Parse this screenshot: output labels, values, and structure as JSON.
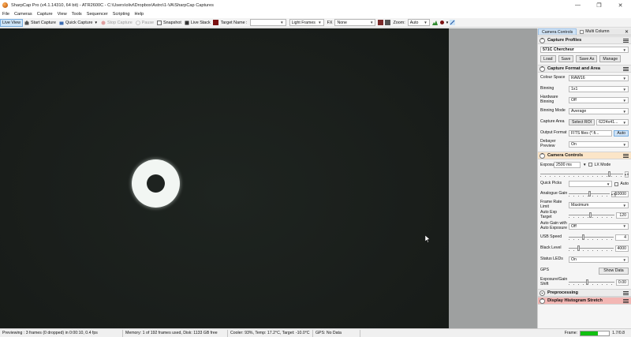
{
  "window": {
    "title": "SharpCap Pro (v4.1.14310, 64 bit) - ATR2600C - C:\\Users\\olivi\\Dropbox\\Astro\\1-VA\\SharpCap Captures",
    "minimize": "—",
    "maximize": "❐",
    "close": "✕"
  },
  "menu": [
    "File",
    "Cameras",
    "Capture",
    "View",
    "Tools",
    "Sequencer",
    "Scripting",
    "Help"
  ],
  "toolbar": {
    "live_view": "Live View",
    "start_capture": "Start Capture",
    "quick_capture": "Quick Capture",
    "stop_capture": "Stop Capture",
    "pause": "Pause",
    "snapshot": "Snapshot",
    "live_stack": "Live Stack",
    "target_name_label": "Target Name :",
    "target_name_value": "",
    "frame_type": "Light Frames",
    "fx_label": "FX",
    "fx_value": "None",
    "zoom_label": "Zoom:",
    "zoom_value": "Auto"
  },
  "panel": {
    "tabs": {
      "camera_controls": "Camera Controls",
      "multi_column": "Multi Column",
      "close": "✕"
    },
    "capture_profiles": {
      "title": "Capture Profiles",
      "profile": "571C Chercheur",
      "load": "Load",
      "save": "Save",
      "save_as": "Save As",
      "manage": "Manage"
    },
    "capture_format": {
      "title": "Capture Format and Area",
      "colour_space_label": "Colour Space",
      "colour_space": "RAW16",
      "binning_label": "Binning",
      "binning": "1x1",
      "hw_binning_label": "Hardware Binning",
      "hw_binning": "Off",
      "binning_mode_label": "Binning Mode",
      "binning_mode": "Average",
      "capture_area_label": "Capture Area",
      "select_roi": "Select ROI",
      "capture_area": "6224x41...",
      "output_format_label": "Output Format",
      "output_format": "FITS files (*.fi...",
      "auto": "Auto",
      "debayer_label": "Debayer Preview",
      "debayer": "On"
    },
    "camera_controls": {
      "title": "Camera Controls",
      "exposure_label": "Exposure",
      "exposure": "2500 ms",
      "lx_mode": "LX Mode",
      "quick_picks_label": "Quick Picks",
      "quick_picks": "",
      "auto": "Auto",
      "analogue_gain_label": "Analogue Gain",
      "analogue_gain": "10000",
      "frame_rate_label": "Frame Rate Limit",
      "frame_rate": "Maximum",
      "auto_exp_target_label": "Auto Exp Target",
      "auto_exp_target": "120",
      "auto_gain_label": "Auto Gain with Auto Exposure",
      "auto_gain": "Off",
      "usb_speed_label": "USB Speed",
      "usb_speed": "4",
      "black_level_label": "Black Level",
      "black_level": "4000",
      "status_leds_label": "Status LEDs",
      "status_leds": "On",
      "gps_label": "GPS",
      "show_data": "Show Data",
      "exp_gain_shift_label": "Exposure/Gain Shift",
      "exp_gain_shift": "0.00"
    },
    "preprocessing": {
      "title": "Preprocessing"
    },
    "histogram": {
      "title": "Display Histogram Stretch"
    }
  },
  "status": {
    "previewing": "Previewing : 3 frames (0 dropped) in 0:00:10, 0.4 fps",
    "memory": "Memory: 1 of 192 frames used, Disk: 1133 GB free",
    "cooler": "Cooler: 93%, Temp: 17.2°C, Target: -10.0°C",
    "gps": "GPS: No Data",
    "frame_label": "Frame:",
    "frame_counter": "1.7/0.8",
    "frame_progress": 0.62
  },
  "colors": {
    "accent": "#11c011",
    "histogram_header": "#f3b7b4",
    "section_header_warm": "#fbe5c8"
  }
}
